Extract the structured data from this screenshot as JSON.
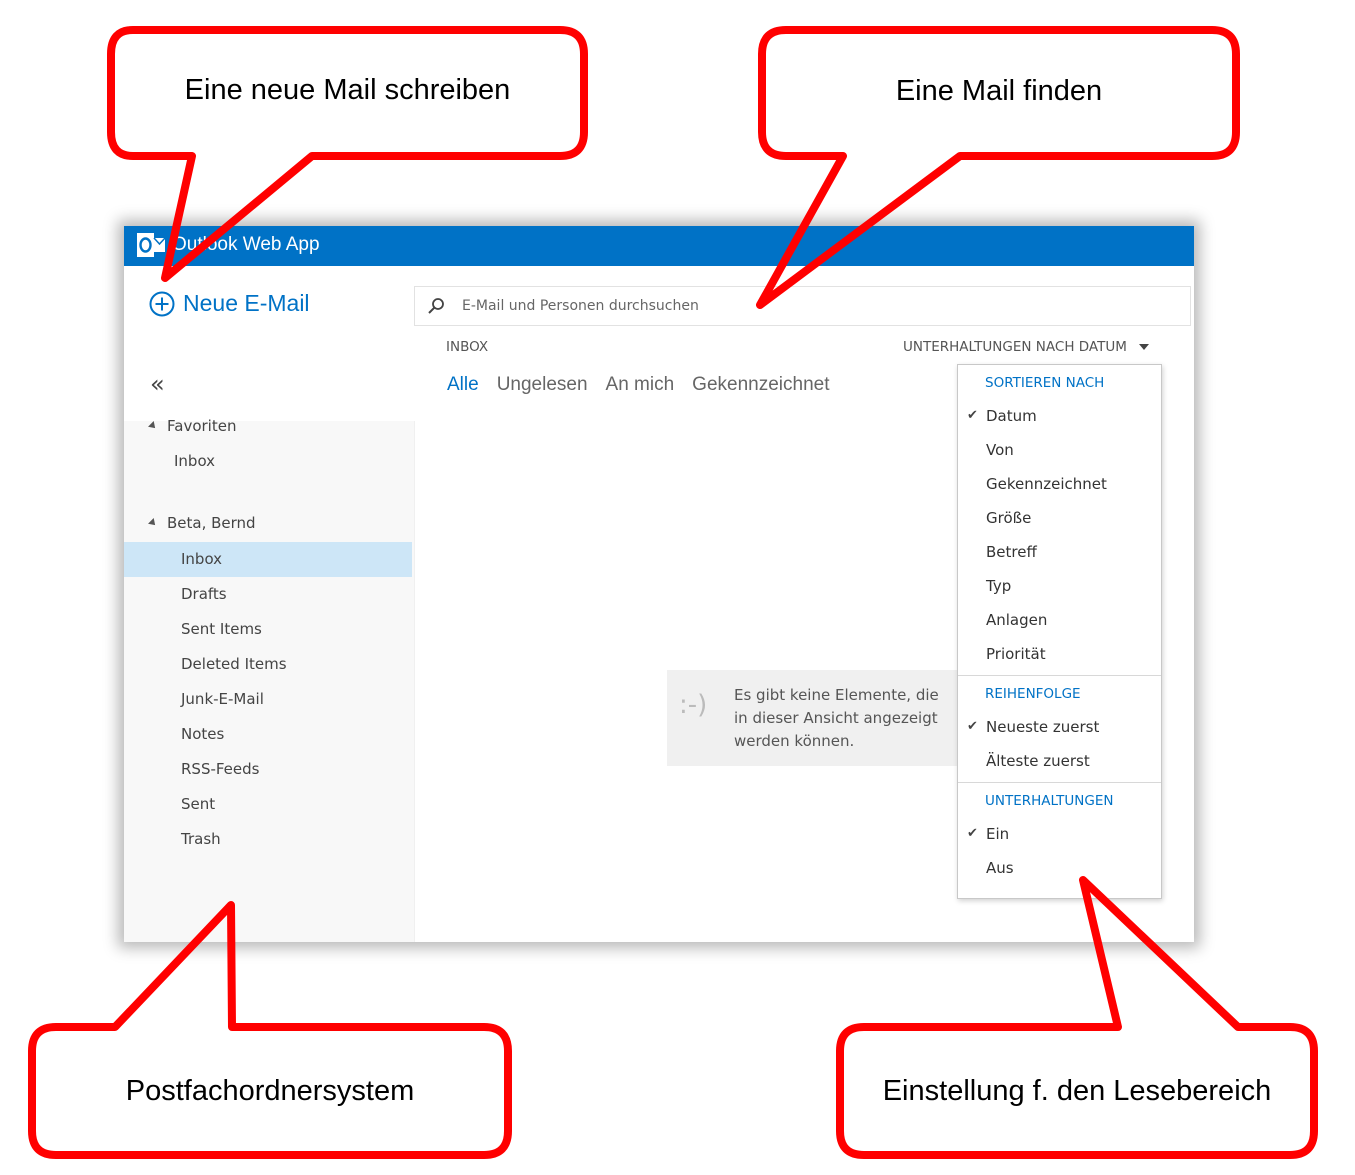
{
  "callouts": {
    "new_mail": "Eine neue Mail schreiben",
    "find_mail": "Eine Mail finden",
    "folders": "Postfachordnersystem",
    "reading": "Einstellung f. den Lesebereich"
  },
  "app": {
    "title": "Outlook Web App",
    "accent": "#0072c6",
    "callout_color": "#ff0000"
  },
  "sidebar": {
    "new_mail": "Neue E-Mail",
    "collapse": "«",
    "favorites_label": "Favoriten",
    "favorites_inbox": "Inbox",
    "account": "Beta, Bernd",
    "folders": [
      {
        "label": "Inbox",
        "selected": true
      },
      {
        "label": "Drafts"
      },
      {
        "label": "Sent Items"
      },
      {
        "label": "Deleted Items"
      },
      {
        "label": "Junk-E-Mail"
      },
      {
        "label": "Notes"
      },
      {
        "label": "RSS-Feeds"
      },
      {
        "label": "Sent"
      },
      {
        "label": "Trash"
      }
    ]
  },
  "search": {
    "placeholder": "E-Mail und Personen durchsuchen"
  },
  "list": {
    "folder_label": "INBOX",
    "sort_label": "UNTERHALTUNGEN NACH DATUM",
    "filters": [
      "Alle",
      "Ungelesen",
      "An mich",
      "Gekennzeichnet"
    ],
    "empty_face": ":-)",
    "empty_message": "Es gibt keine Elemente, die in dieser Ansicht angezeigt werden können."
  },
  "sort_menu": {
    "sections": [
      {
        "header": "SORTIEREN NACH",
        "items": [
          {
            "label": "Datum",
            "checked": true
          },
          {
            "label": "Von"
          },
          {
            "label": "Gekennzeichnet"
          },
          {
            "label": "Größe"
          },
          {
            "label": "Betreff"
          },
          {
            "label": "Typ"
          },
          {
            "label": "Anlagen"
          },
          {
            "label": "Priorität"
          }
        ]
      },
      {
        "header": "REIHENFOLGE",
        "items": [
          {
            "label": "Neueste zuerst",
            "checked": true
          },
          {
            "label": "Älteste zuerst"
          }
        ]
      },
      {
        "header": "UNTERHALTUNGEN",
        "items": [
          {
            "label": "Ein",
            "checked": true
          },
          {
            "label": "Aus"
          }
        ]
      }
    ]
  }
}
